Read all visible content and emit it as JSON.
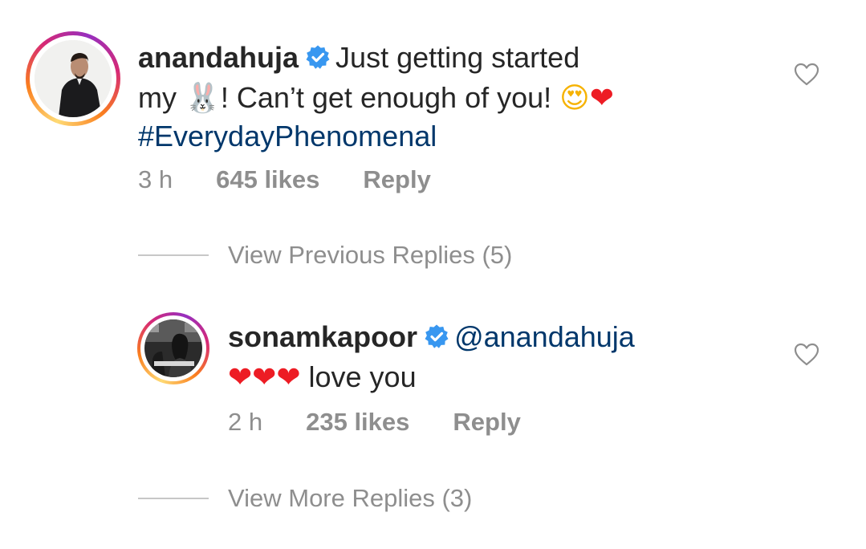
{
  "comment": {
    "username": "anandahuja",
    "text_line1": "Just getting started",
    "text_line2_prefix": "my",
    "emoji_bunny": "🐰",
    "text_line2_mid": "! Can’t get enough of you!",
    "emoji_heart_eyes": "😍",
    "emoji_heart": "❤",
    "hashtag": "#EverydayPhenomenal",
    "time": "3 h",
    "likes": "645 likes",
    "reply_label": "Reply"
  },
  "view_previous": {
    "label": "View Previous Replies (5)"
  },
  "reply": {
    "username": "sonamkapoor",
    "mention": "@anandahuja",
    "hearts": "❤❤❤",
    "text": "love you",
    "time": "2 h",
    "likes": "235 likes",
    "reply_label": "Reply"
  },
  "view_more": {
    "label": "View More Replies (3)"
  },
  "colors": {
    "link": "#00376b",
    "verified": "#3897f0",
    "secondary": "#8e8e8e",
    "heart_red": "#ed1c24"
  }
}
